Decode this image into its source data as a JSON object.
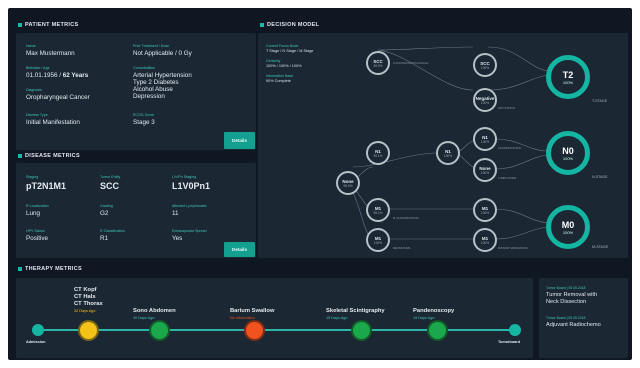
{
  "patient": {
    "section_title": "PATIENT METRICS",
    "name_label": "Name",
    "name": "Max Mustermann",
    "birthdate_label": "Birthdate / Age",
    "birthdate": "01.01.1956 / ",
    "age": "62 Years",
    "diagnosis_label": "Diagnosis",
    "diagnosis": "Oropharyngeal Cancer",
    "disease_type_label": "Disease Type",
    "disease_type": "Initial Manifestation",
    "prior_label": "Prior Treatment / Dose",
    "prior": "Not Applicable / 0 Gy",
    "comorb_label": "Comorbidities",
    "comorb": [
      "Arterial Hypertension",
      "Type 2 Diabetes",
      "Alcohol Abuse",
      "Depression"
    ],
    "ecog_label": "ECOG Score",
    "ecog": "Stage 3",
    "details_label": "Details"
  },
  "disease": {
    "section_title": "DISEASE METRICS",
    "staging_label": "Staging",
    "staging": "pT2N1M1",
    "tumor_label": "Tumor Entity",
    "tumor": "SCC",
    "lvpn_label": "L/V/Pn Staging",
    "lvpn": "L1V0Pn1",
    "loc_label": "R Localization",
    "loc": "Lung",
    "grading_label": "Grading",
    "grading": "G2",
    "lymph_label": "Affected Lymphnodes",
    "lymph": "11",
    "hpv_label": "HPV Status",
    "hpv": "Positive",
    "rclass_label": "R Classification",
    "rclass": "R1",
    "extracap_label": "Extracapsular Spread",
    "extracap": "Yes",
    "details_label": "Details"
  },
  "decision": {
    "section_title": "DECISION MODEL",
    "current_label": "Current Focus Node",
    "current": "T Stage / N Stage / M Stage",
    "certainty_label": "Certainty",
    "certainty": "100% / 100% / 100%",
    "info_label": "Information Base",
    "info": "90% Complete",
    "nodes": [
      {
        "label": "SCC",
        "pct": "95.0%"
      },
      {
        "label": "SCC",
        "pct": "100%"
      },
      {
        "label": "Negative",
        "pct": "100%"
      },
      {
        "label": "N1",
        "pct": "100%"
      },
      {
        "label": "N1",
        "pct": "95.1%"
      },
      {
        "label": "N1",
        "pct": "100%"
      },
      {
        "label": "None",
        "pct": "100%"
      },
      {
        "label": "N1",
        "pct": "100%"
      },
      {
        "label": "None",
        "pct": "95.0%"
      },
      {
        "label": "M1",
        "pct": "95.1%"
      },
      {
        "label": "M1",
        "pct": "100%"
      },
      {
        "label": "M1",
        "pct": "100%"
      },
      {
        "label": "M1",
        "pct": "100%"
      }
    ],
    "small_labels": [
      "LOCATION/HISTOLOGICAL",
      "HPV STATUS",
      "CLASSIFICATION",
      "LYMPH NODE",
      "R CLASSIFICATION",
      "METASTASIS",
      "DISTANT METASTASIS"
    ],
    "results": [
      {
        "label": "T2",
        "pct": "100%",
        "stage": "T-STAGE"
      },
      {
        "label": "N0",
        "pct": "100%",
        "stage": "N-STAGE"
      },
      {
        "label": "M0",
        "pct": "100%",
        "stage": "M-STAGE"
      }
    ]
  },
  "therapy": {
    "section_title": "THERAPY METRICS",
    "start_label": "Admission",
    "end_label": "Tumorboard",
    "events": [
      {
        "lines": [
          "CT Kopf",
          "CT Hals",
          "CT Thorax"
        ],
        "date": "32 Days Ago",
        "color": "#f5c218",
        "date_color": "#f5c218"
      },
      {
        "lines": [
          "Sono Abdomen"
        ],
        "date": "30 Days Ago",
        "color": "#1aa84a",
        "date_color": "#3ec7b6"
      },
      {
        "lines": [
          "Barium Swallow"
        ],
        "date": "No information",
        "color": "#f0531f",
        "date_color": "#f0531f"
      },
      {
        "lines": [
          "Skeletal Scintigraphy"
        ],
        "date": "19 Days Ago",
        "color": "#1aa84a",
        "date_color": "#3ec7b6"
      },
      {
        "lines": [
          "Pandenoscopy"
        ],
        "date": "15 Days Ago",
        "color": "#1aa84a",
        "date_color": "#3ec7b6"
      }
    ],
    "boards": [
      {
        "label": "Tumor Board | 05.05.2018",
        "text": [
          "Tumor Removal with",
          "Neck Dissection"
        ]
      },
      {
        "label": "Tumor Board | 05.05.2018",
        "text": [
          "Adjuvant Radiochemo"
        ]
      }
    ]
  }
}
